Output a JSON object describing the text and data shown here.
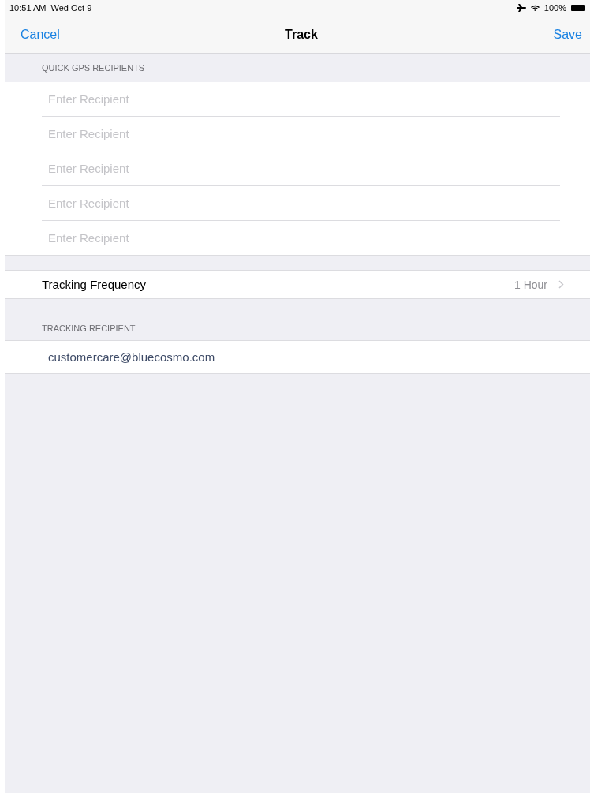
{
  "status_bar": {
    "time": "10:51 AM",
    "date": "Wed Oct 9",
    "battery": "100%"
  },
  "nav": {
    "cancel": "Cancel",
    "title": "Track",
    "save": "Save"
  },
  "quick_gps": {
    "header": "QUICK GPS RECIPIENTS",
    "fields": [
      {
        "placeholder": "Enter Recipient"
      },
      {
        "placeholder": "Enter Recipient"
      },
      {
        "placeholder": "Enter Recipient"
      },
      {
        "placeholder": "Enter Recipient"
      },
      {
        "placeholder": "Enter Recipient"
      }
    ]
  },
  "tracking_frequency": {
    "label": "Tracking Frequency",
    "value": "1 Hour"
  },
  "tracking_recipient": {
    "header": "TRACKING RECIPIENT",
    "value": "customercare@bluecosmo.com"
  }
}
